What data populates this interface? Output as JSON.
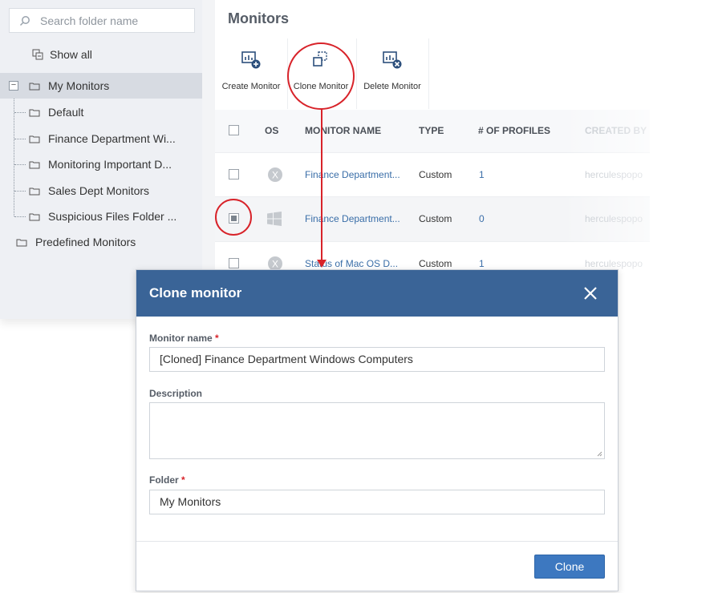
{
  "sidebar": {
    "search_placeholder": "Search folder name",
    "show_all": "Show all",
    "root": "My Monitors",
    "folders": [
      "Default",
      "Finance Department Wi...",
      "Monitoring Important D...",
      "Sales Dept Monitors",
      "Suspicious Files Folder ..."
    ],
    "predefined": "Predefined Monitors"
  },
  "main": {
    "title": "Monitors",
    "toolbar": {
      "create": "Create Monitor",
      "clone": "Clone Monitor",
      "delete": "Delete Monitor"
    },
    "table": {
      "headers": {
        "os": "OS",
        "name": "MONITOR NAME",
        "type": "TYPE",
        "profiles": "# OF PROFILES",
        "created_by": "CREATED BY"
      },
      "rows": [
        {
          "os_icon": "mac-x-icon",
          "name": "Finance Department...",
          "type": "Custom",
          "profiles": "1",
          "created_by": "herculespopo",
          "checked": false
        },
        {
          "os_icon": "windows-icon",
          "name": "Finance Department...",
          "type": "Custom",
          "profiles": "0",
          "created_by": "herculespopo",
          "checked": true
        },
        {
          "os_icon": "mac-x-icon",
          "name": "Status of Mac OS D...",
          "type": "Custom",
          "profiles": "1",
          "created_by": "herculespopo",
          "checked": false
        }
      ]
    }
  },
  "dialog": {
    "title": "Clone monitor",
    "monitor_name_label": "Monitor name",
    "monitor_name_value": "[Cloned] Finance Department Windows Computers",
    "description_label": "Description",
    "description_value": "",
    "folder_label": "Folder",
    "folder_value": "My Monitors",
    "required_mark": "*",
    "clone_button": "Clone"
  },
  "colors": {
    "header_blue": "#3a6497",
    "primary_button": "#3d78c0",
    "link": "#3a6ea8",
    "annotation_red": "#d8232a"
  }
}
